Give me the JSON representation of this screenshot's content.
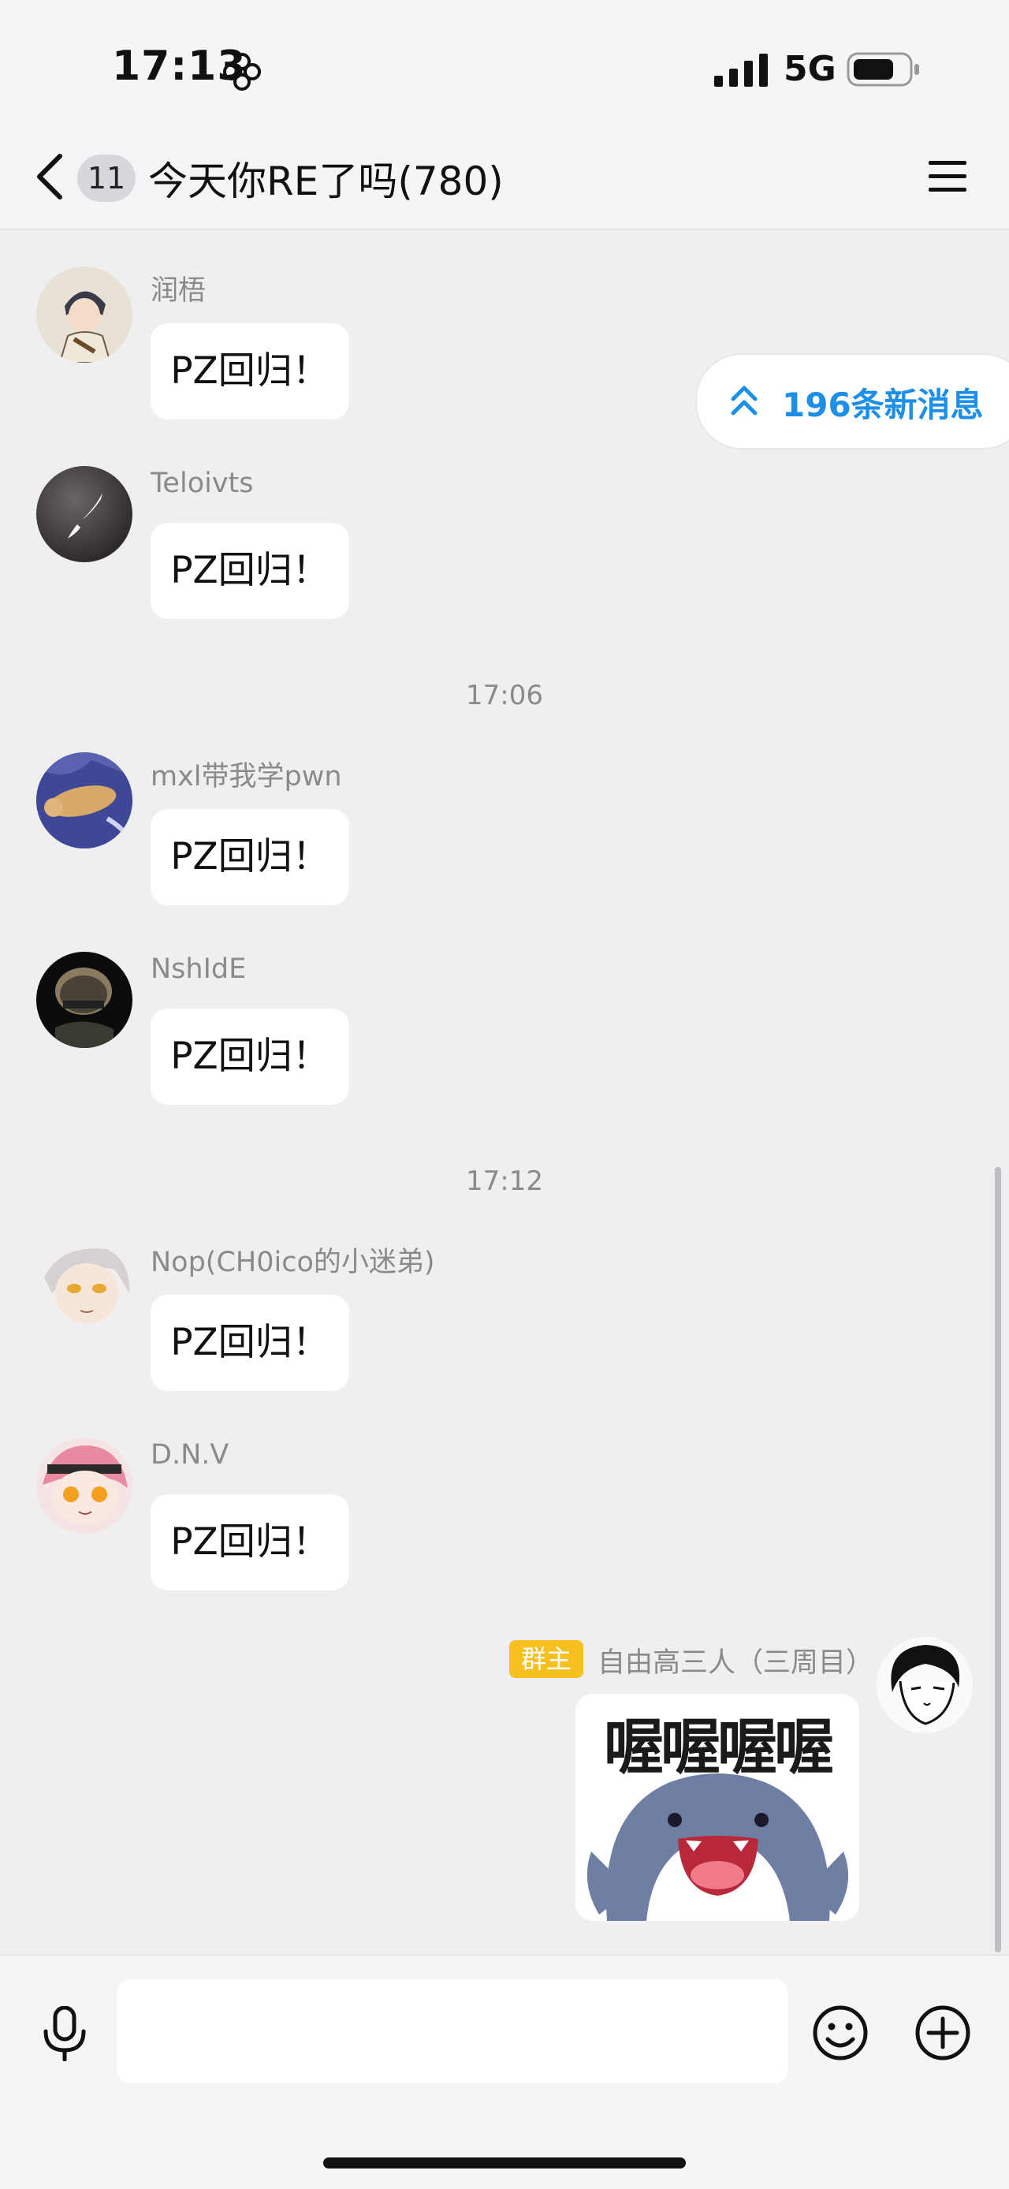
{
  "status_bar": {
    "time": "17:13",
    "network": "5G"
  },
  "header": {
    "unread_count": "11",
    "title": "今天你RE了吗(780)"
  },
  "new_messages_pill": "196条新消息",
  "messages": [
    {
      "sender": "润梧",
      "text": "PZ回归！"
    },
    {
      "sender": "Teloivts",
      "text": "PZ回归！"
    },
    {
      "timestamp": "17:06"
    },
    {
      "sender": "mxl带我学pwn",
      "text": "PZ回归！"
    },
    {
      "sender": "NshIdE",
      "text": "PZ回归！"
    },
    {
      "timestamp": "17:12"
    },
    {
      "sender": "Nop(CH0ico的小迷弟)",
      "text": "PZ回归！"
    },
    {
      "sender": "D.N.V",
      "text": "PZ回归！"
    },
    {
      "sender": "自由高三人（三周目）",
      "role": "群主",
      "sticker_text": "喔喔喔喔"
    }
  ],
  "input": {
    "placeholder": ""
  },
  "colors": {
    "accent": "#1e8fe6",
    "owner_tag": "#f5c020",
    "background": "#efefef"
  },
  "icons": [
    "back-chevron-icon",
    "menu-icon",
    "double-chevron-up-icon",
    "microphone-icon",
    "emoji-icon",
    "plus-icon"
  ]
}
